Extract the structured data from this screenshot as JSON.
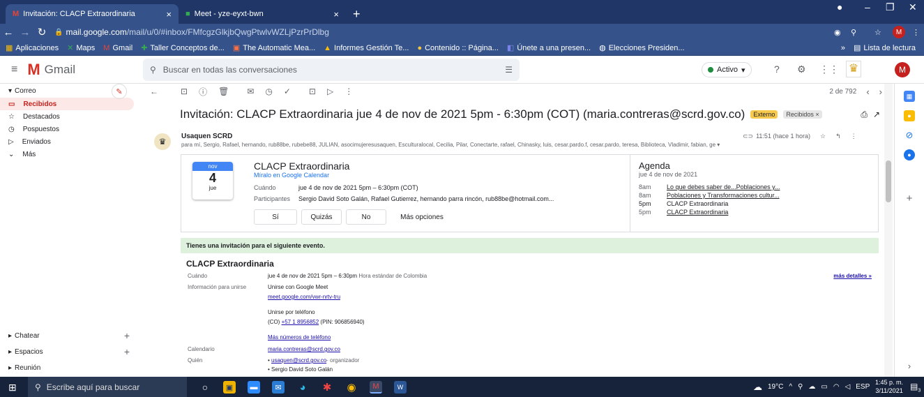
{
  "browser": {
    "tabs": [
      {
        "label": "Invitación: CLACP Extraordinaria",
        "icon": "gmail-icon"
      },
      {
        "label": "Meet - yze-eyxt-bwn",
        "icon": "meet-icon"
      }
    ],
    "url_host": "mail.google.com",
    "url_path": "/mail/u/0/#inbox/FMfcgzGlkjbQwgPtwlvWZLjPzrPrDlbg",
    "profile_initial": "M",
    "bookmarks": [
      "Aplicaciones",
      "Maps",
      "Gmail",
      "Taller Conceptos de...",
      "The Automatic Mea...",
      "Informes Gestión Te...",
      "Contenido :: Página...",
      "Únete a una presen...",
      "Elecciones Presiden..."
    ],
    "reading_list": "Lista de lectura",
    "more": "»"
  },
  "gmail": {
    "brand": "Gmail",
    "search_placeholder": "Buscar en todas las conversaciones",
    "status": "Activo",
    "avatar_initial": "M"
  },
  "sidebar": {
    "section": "Correo",
    "items": [
      {
        "label": "Recibidos",
        "icon": "inbox-icon"
      },
      {
        "label": "Destacados",
        "icon": "star-icon"
      },
      {
        "label": "Pospuestos",
        "icon": "clock-icon"
      },
      {
        "label": "Enviados",
        "icon": "send-icon"
      },
      {
        "label": "Más",
        "icon": "chevron-down-icon"
      }
    ],
    "bottom": [
      "Chatear",
      "Espacios",
      "Reunión"
    ]
  },
  "toolbar": {
    "pager": "2 de 792"
  },
  "email": {
    "subject": "Invitación: CLACP Extraordinaria jue 4 de nov de 2021 5pm - 6:30pm (COT) (maria.contreras@scrd.gov.co)",
    "label_external": "Externo",
    "label_inbox": "Recibidos ×",
    "sender": "Usaquen SCRD",
    "recipients": "para mí, Sergio, Rafael, hernando, rub88be, rubebe88, JULIAN, asocimujeresusaquen, Esculturalocal, Cecilia, Pilar, Conectarte, rafael, Chinasky, luis, cesar.pardo.f, cesar.pardo, teresa, Biblioteca, Vladimir, fabian, ge ▾",
    "time": "11:51 (hace 1 hora)"
  },
  "event_card": {
    "month": "nov",
    "day": "4",
    "weekday": "jue",
    "title": "CLACP Extraordinaria",
    "calendar_link": "Míralo en Google Calendar",
    "when_label": "Cuándo",
    "when": "jue 4 de nov de 2021 5pm – 6:30pm (COT)",
    "participants_label": "Participantes",
    "participants": "Sergio David Soto Galán, Rafael Gutierrez, hernando parra rincón, rub88be@hotmail.com...",
    "rsvp": [
      "Sí",
      "Quizás",
      "No"
    ],
    "more_options": "Más opciones",
    "agenda_title": "Agenda",
    "agenda_date": "jue 4 de nov de 2021",
    "agenda": [
      {
        "time": "8am",
        "event": "Lo que debes saber de...Poblaciones y..."
      },
      {
        "time": "8am",
        "event": "Poblaciones y Transformaciones cultur..."
      },
      {
        "time": "5pm",
        "event": "CLACP Extraordinaria"
      },
      {
        "time": "5pm",
        "event": "CLACP Extraordinaria"
      }
    ]
  },
  "invite": {
    "banner": "Tienes una invitación para el siguiente evento.",
    "title": "CLACP Extraordinaria",
    "when_label": "Cuándo",
    "when": "jue 4 de nov de 2021 5pm – 6:30pm",
    "when_tz": "Hora estándar de Colombia",
    "details": "más detalles »",
    "join_label": "Información para unirse",
    "join_meet": "Unirse con Google Meet",
    "meet_link": "meet.google.com/vwr-nrtv-tru",
    "join_phone": "Unirse por teléfono",
    "phone_prefix": "(CO)",
    "phone": "+57 1 8956852",
    "pin": "(PIN: 906856940)",
    "more_numbers": "Más números de teléfono",
    "calendar_label": "Calendario",
    "calendar": "maria.contreras@scrd.gov.co",
    "who_label": "Quién",
    "who": [
      {
        "name": "usaquen@scrd.gov.co",
        "role": "- organizador"
      },
      {
        "name": "Sergio David Soto Galán",
        "role": ""
      }
    ]
  },
  "taskbar": {
    "search": "Escribe aquí para buscar",
    "temp": "19°C",
    "lang": "ESP",
    "time": "1:45 p. m.",
    "date": "3/11/2021",
    "notif_count": "3"
  },
  "colors": {
    "gmail_red": "#d93025",
    "chrome_bg": "#35538a",
    "tab_bg": "#1f3666",
    "external_badge": "#f7ca4d"
  }
}
